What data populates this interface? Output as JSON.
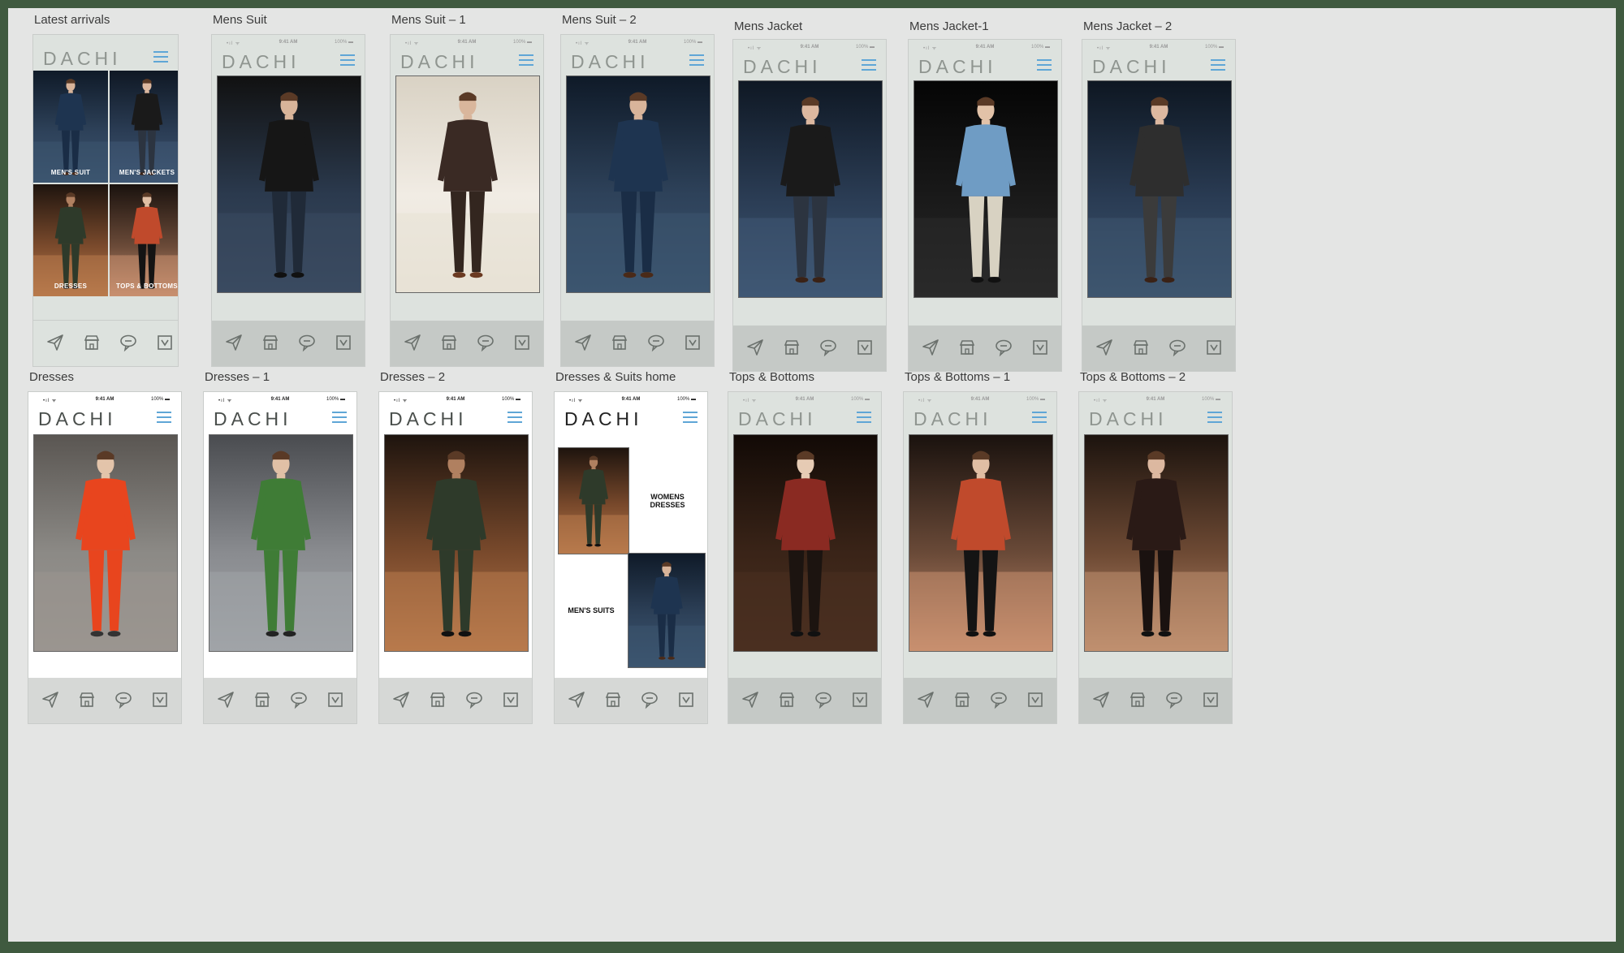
{
  "app": {
    "logo": "DACHI"
  },
  "status": {
    "signal": "•ıl ᯤ",
    "time": "9:41 AM",
    "battery": "100% ▬"
  },
  "tabbar": {
    "icons": [
      "send-icon",
      "store-icon",
      "chat-icon",
      "checkbox-icon"
    ]
  },
  "colors": {
    "accent": "#5fa6d6",
    "canvas": "#e4e5e4",
    "frame": "#3f5a3f"
  },
  "artboards": [
    {
      "label": "Latest arrivals",
      "tiles": [
        "MEN'S SUIT",
        "MEN'S JACKETS",
        "DRESSES",
        "TOPS & BOTTOMS"
      ]
    },
    {
      "label": "Mens Suit"
    },
    {
      "label": "Mens Suit – 1"
    },
    {
      "label": "Mens Suit – 2"
    },
    {
      "label": "Mens Jacket"
    },
    {
      "label": "Mens Jacket-1"
    },
    {
      "label": "Mens Jacket – 2"
    },
    {
      "label": "Dresses"
    },
    {
      "label": "Dresses – 1"
    },
    {
      "label": "Dresses – 2"
    },
    {
      "label": "Dresses & Suits home",
      "captions": [
        "WOMENS DRESSES",
        "MEN'S SUITS"
      ]
    },
    {
      "label": "Tops & Bottoms"
    },
    {
      "label": "Tops & Bottoms – 1"
    },
    {
      "label": "Tops & Bottoms – 2"
    }
  ]
}
